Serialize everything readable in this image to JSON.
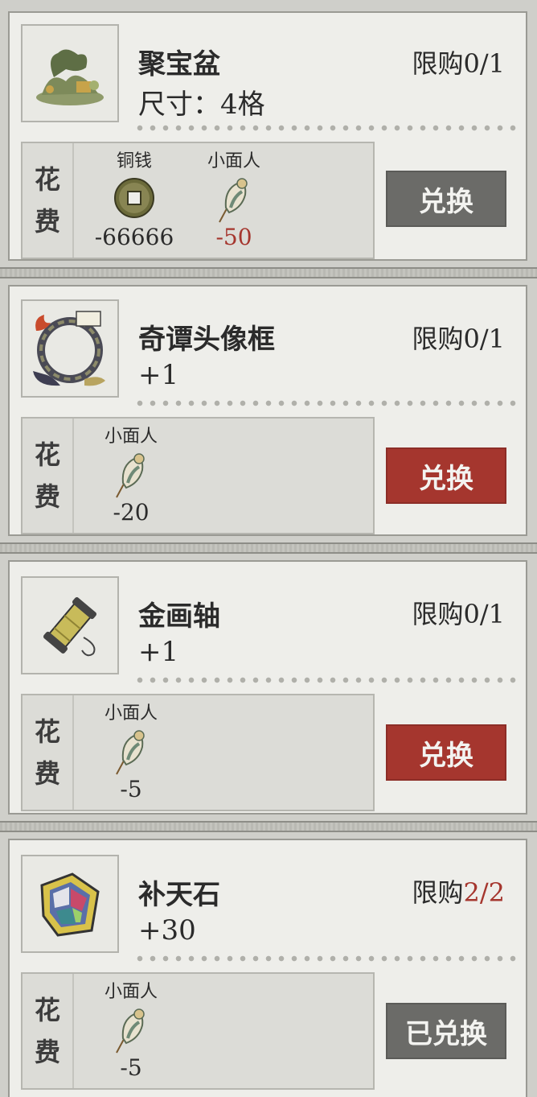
{
  "colors": {
    "accent_red": "#a5362e",
    "disabled_gray": "#6b6b68",
    "card_bg": "#eeeeea"
  },
  "cost_label": [
    "花",
    "费"
  ],
  "limit_prefix": "限购",
  "items": [
    {
      "name": "聚宝盆",
      "sub": "尺寸：4格",
      "limit_used": "0/1",
      "limit_full": false,
      "icon": "bonsai-pot-icon",
      "button": "兑换",
      "button_state": "disabled",
      "costs": [
        {
          "name": "铜钱",
          "icon": "copper-coin-icon",
          "value": "-66666",
          "insufficient": false
        },
        {
          "name": "小面人",
          "icon": "dough-figure-icon",
          "value": "-50",
          "insufficient": true
        }
      ]
    },
    {
      "name": "奇谭头像框",
      "sub": "+1",
      "limit_used": "0/1",
      "limit_full": false,
      "icon": "avatar-frame-icon",
      "button": "兑换",
      "button_state": "active",
      "costs": [
        {
          "name": "小面人",
          "icon": "dough-figure-icon",
          "value": "-20",
          "insufficient": false
        }
      ]
    },
    {
      "name": "金画轴",
      "sub": "+1",
      "limit_used": "0/1",
      "limit_full": false,
      "icon": "golden-scroll-icon",
      "button": "兑换",
      "button_state": "active",
      "costs": [
        {
          "name": "小面人",
          "icon": "dough-figure-icon",
          "value": "-5",
          "insufficient": false
        }
      ]
    },
    {
      "name": "补天石",
      "sub": "+30",
      "limit_used": "2/2",
      "limit_full": true,
      "icon": "rainbow-stone-icon",
      "button": "已兑换",
      "button_state": "disabled",
      "costs": [
        {
          "name": "小面人",
          "icon": "dough-figure-icon",
          "value": "-5",
          "insufficient": false
        }
      ]
    }
  ]
}
